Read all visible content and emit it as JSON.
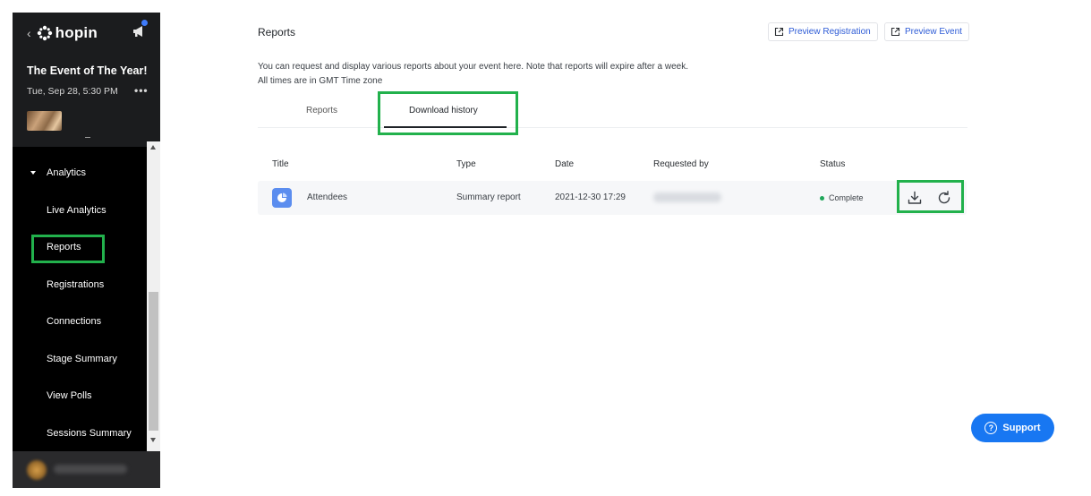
{
  "sidebar": {
    "logo_text": "hopin",
    "event_title": "The Event of The Year!",
    "event_date": "Tue, Sep 28, 5:30 PM",
    "more_glyph": "•••",
    "group_label": "Analytics",
    "items": [
      {
        "label": "Live Analytics"
      },
      {
        "label": "Reports"
      },
      {
        "label": "Registrations"
      },
      {
        "label": "Connections"
      },
      {
        "label": "Stage Summary"
      },
      {
        "label": "View Polls"
      },
      {
        "label": "Sessions Summary"
      }
    ]
  },
  "header": {
    "title": "Reports",
    "preview_registration": "Preview Registration",
    "preview_event": "Preview Event"
  },
  "description": {
    "line1": "You can request and display various reports about your event here. Note that reports will expire after a week.",
    "line2": "All times are in GMT Time zone"
  },
  "tabs": [
    {
      "label": "Reports",
      "active": false
    },
    {
      "label": "Download history",
      "active": true
    }
  ],
  "table": {
    "columns": [
      "Title",
      "Type",
      "Date",
      "Requested by",
      "Status"
    ],
    "rows": [
      {
        "title": "Attendees",
        "type": "Summary report",
        "date": "2021-12-30 17:29",
        "status": "Complete"
      }
    ]
  },
  "colors": {
    "accent": "#1877f2",
    "highlight": "#22b14c",
    "status_complete": "#1fa75a"
  },
  "support_label": "Support"
}
